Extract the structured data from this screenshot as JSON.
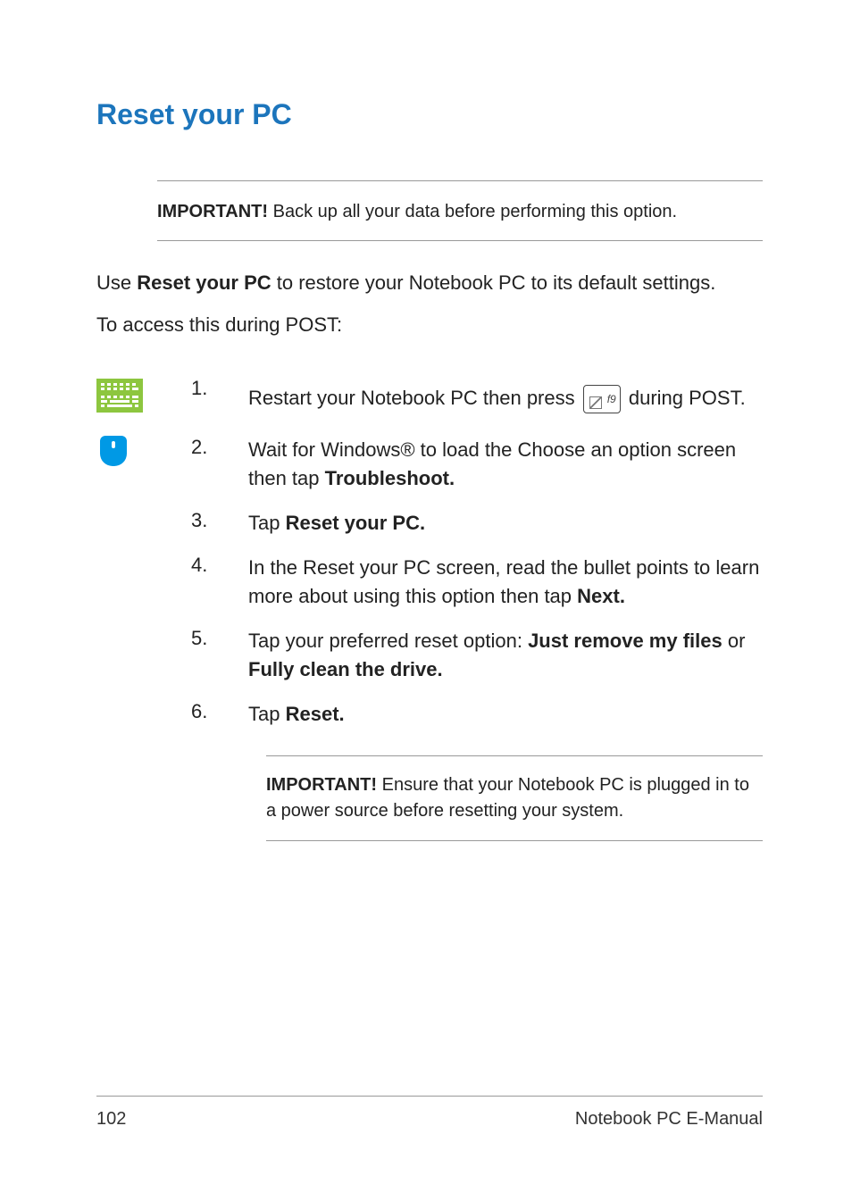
{
  "title": "Reset your PC",
  "callout_top": {
    "label": "IMPORTANT!",
    "text": " Back up all your data before performing this option."
  },
  "intro": {
    "prefix": "Use ",
    "bold": "Reset your PC",
    "suffix": " to restore your Notebook PC to its default settings."
  },
  "sub_intro": "To access this during POST:",
  "steps": [
    {
      "num": "1.",
      "segments": [
        {
          "t": "Restart your Notebook PC then press "
        },
        {
          "key": true
        },
        {
          "t": " during POST."
        }
      ]
    },
    {
      "num": "2.",
      "segments": [
        {
          "t": "Wait for Windows® to load the Choose an option screen then tap "
        },
        {
          "b": "Troubleshoot."
        }
      ]
    },
    {
      "num": "3.",
      "segments": [
        {
          "t": "Tap "
        },
        {
          "b": "Reset your PC."
        }
      ]
    },
    {
      "num": "4.",
      "segments": [
        {
          "t": "In the Reset your PC screen, read the bullet points to learn more about using this option then tap "
        },
        {
          "b": "Next."
        }
      ]
    },
    {
      "num": "5.",
      "segments": [
        {
          "t": "Tap your preferred reset option: "
        },
        {
          "b": "Just remove my files"
        },
        {
          "t": " or "
        },
        {
          "b": "Fully clean the drive."
        }
      ]
    },
    {
      "num": "6.",
      "segments": [
        {
          "t": "Tap "
        },
        {
          "b": "Reset."
        }
      ]
    }
  ],
  "callout_bottom": {
    "label": "IMPORTANT!",
    "text": " Ensure that your Notebook PC is plugged in to a power source before resetting your system."
  },
  "footer": {
    "page": "102",
    "doc": "Notebook PC E-Manual"
  }
}
